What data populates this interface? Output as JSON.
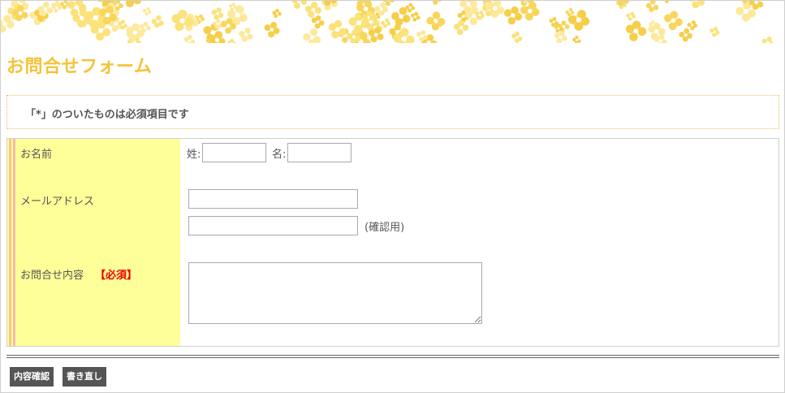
{
  "header": {
    "banner_pattern": "yellow-flower-pattern",
    "title": "お問合せフォーム",
    "title_color": "#f6c338"
  },
  "notice": {
    "text": "「*」のついたものは必須項目です"
  },
  "form": {
    "label_bg": "#ffff99",
    "name_label": "お名前",
    "last_name_prefix": "姓:",
    "first_name_prefix": "名:",
    "last_name_value": "",
    "first_name_value": "",
    "email_label": "メールアドレス",
    "email_value": "",
    "email_confirm_value": "",
    "email_confirm_note": "(確認用)",
    "inquiry_label": "お問合せ内容",
    "required_mark": "【必須】",
    "required_color": "#ee0000",
    "inquiry_value": ""
  },
  "buttons": {
    "confirm_label": "内容確認",
    "reset_label": "書き直し"
  }
}
